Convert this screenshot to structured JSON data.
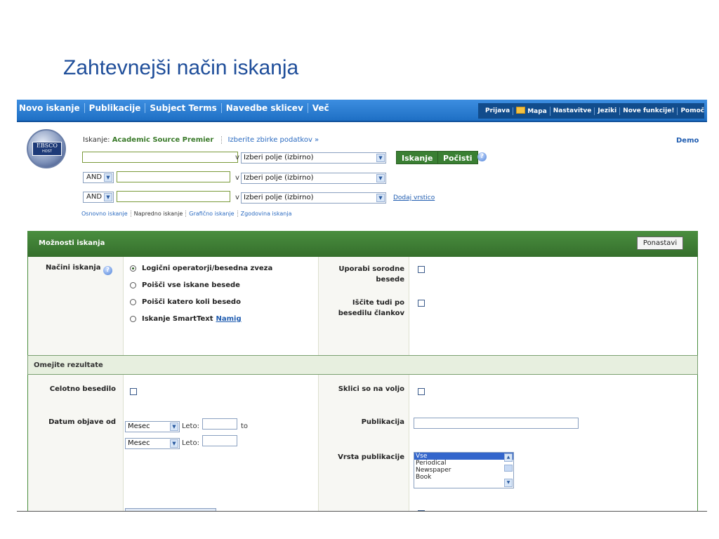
{
  "slide_title": "Zahtevnejši način iskanja",
  "topnav": {
    "left": [
      "Novo iskanje",
      "Publikacije",
      "Subject Terms",
      "Navedbe sklicev",
      "Več"
    ],
    "right": [
      "Prijava",
      "Mapa",
      "Nastavitve",
      "Jeziki",
      "Nove funkcije!",
      "Pomoč"
    ]
  },
  "logo": {
    "main": "EBSCO",
    "sub": "HOST"
  },
  "search": {
    "db_prefix": "Iskanje:",
    "db_name": "Academic Source Premier",
    "db_choose": "Izberite zbirke podatkov »",
    "demo": "Demo",
    "in_label": "v",
    "field_placeholder": "Izberi polje (izbirno)",
    "operator": "AND",
    "search_button": "Iskanje",
    "clear_button": "Počisti",
    "add_row": "Dodaj vrstico",
    "links": [
      "Osnovno iskanje",
      "Napredno iskanje",
      "Grafično iskanje",
      "Zgodovina iskanja"
    ]
  },
  "options": {
    "title": "Možnosti iskanja",
    "reset": "Ponastavi",
    "modes_label": "Načini iskanja",
    "modes": [
      "Logični operatorji/besedna zveza",
      "Poišči vse iskane besede",
      "Poišči katero koli besedo",
      "Iskanje SmartText"
    ],
    "selected_mode": 0,
    "hint_link": "Namig",
    "related_words": "Uporabi sorodne besede",
    "fulltext_search": "Iščite tudi po besedilu člankov"
  },
  "limits": {
    "title": "Omejite rezultate",
    "full_text": "Celotno besedilo",
    "references": "Sklici so na voljo",
    "date_label": "Datum objave od",
    "month": "Mesec",
    "year_label": "Leto:",
    "to": "to",
    "publication": "Publikacija",
    "pub_type": "Vrsta publikacije",
    "pub_types": [
      "Vse",
      "Periodical",
      "Newspaper",
      "Book"
    ]
  },
  "colors": {
    "nav_blue": "#1e6fc4",
    "green": "#3a7f33",
    "title_blue": "#1f4e9a"
  }
}
